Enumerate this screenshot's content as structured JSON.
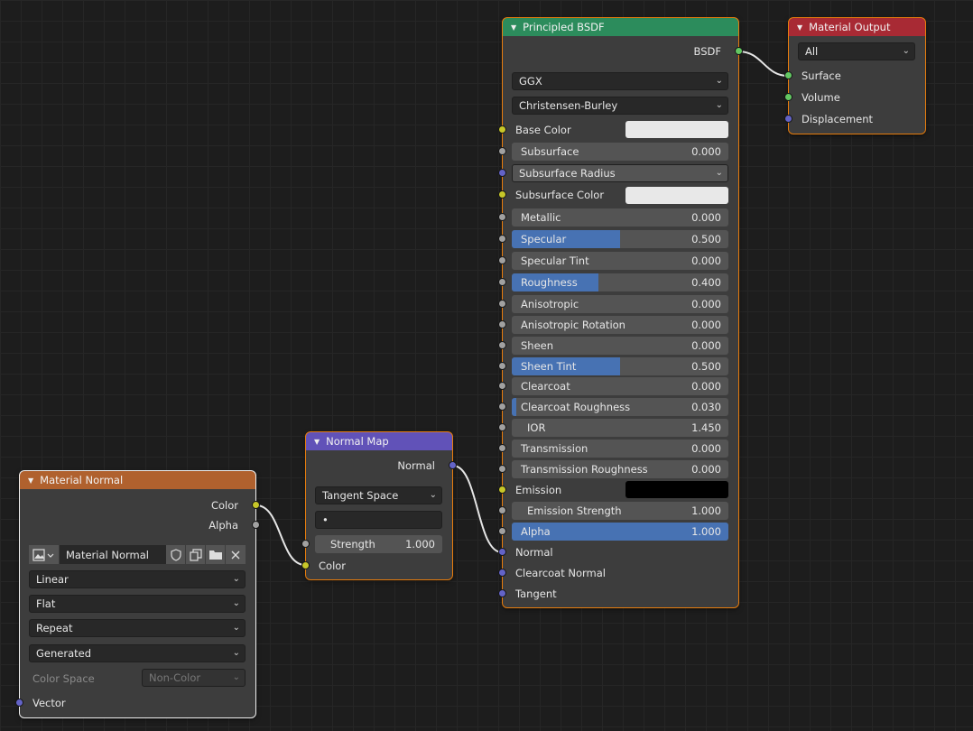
{
  "nodes": {
    "principled": {
      "title": "Principled BSDF",
      "output_label": "BSDF",
      "distribution": "GGX",
      "subsurface_method": "Christensen-Burley",
      "base_color_label": "Base Color",
      "subsurface": {
        "label": "Subsurface",
        "value": "0.000"
      },
      "subsurface_radius": "Subsurface Radius",
      "subsurface_color_label": "Subsurface Color",
      "metallic": {
        "label": "Metallic",
        "value": "0.000"
      },
      "specular": {
        "label": "Specular",
        "value": "0.500",
        "fraction": 0.5
      },
      "specular_tint": {
        "label": "Specular Tint",
        "value": "0.000"
      },
      "roughness": {
        "label": "Roughness",
        "value": "0.400",
        "fraction": 0.4
      },
      "anisotropic": {
        "label": "Anisotropic",
        "value": "0.000"
      },
      "anisotropic_rotation": {
        "label": "Anisotropic Rotation",
        "value": "0.000"
      },
      "sheen": {
        "label": "Sheen",
        "value": "0.000"
      },
      "sheen_tint": {
        "label": "Sheen Tint",
        "value": "0.500",
        "fraction": 0.5
      },
      "clearcoat": {
        "label": "Clearcoat",
        "value": "0.000"
      },
      "clearcoat_roughness": {
        "label": "Clearcoat Roughness",
        "value": "0.030",
        "fraction": 0.03
      },
      "ior": {
        "label": "IOR",
        "value": "1.450"
      },
      "transmission": {
        "label": "Transmission",
        "value": "0.000"
      },
      "transmission_roughness": {
        "label": "Transmission Roughness",
        "value": "0.000"
      },
      "emission_label": "Emission",
      "emission_strength": {
        "label": "Emission Strength",
        "value": "1.000"
      },
      "alpha": {
        "label": "Alpha",
        "value": "1.000",
        "fraction": 1.0
      },
      "normal_label": "Normal",
      "clearcoat_normal_label": "Clearcoat Normal",
      "tangent_label": "Tangent",
      "header_color": "#2c8c5c"
    },
    "material_output": {
      "title": "Material Output",
      "target": "All",
      "surface_label": "Surface",
      "volume_label": "Volume",
      "displacement_label": "Displacement",
      "header_color": "#a82a34"
    },
    "normal_map": {
      "title": "Normal Map",
      "output_label": "Normal",
      "space": "Tangent Space",
      "uv_map": "•",
      "strength": {
        "label": "Strength",
        "value": "1.000"
      },
      "color_label": "Color",
      "header_color": "#6152b8"
    },
    "image_texture": {
      "title": "Material Normal",
      "color_label": "Color",
      "alpha_label": "Alpha",
      "image_name": "Material Normal",
      "interpolation": "Linear",
      "projection": "Flat",
      "extension": "Repeat",
      "source": "Generated",
      "color_space_label": "Color Space",
      "color_space": "Non-Color",
      "vector_label": "Vector",
      "header_color": "#b0612e"
    }
  },
  "colors": {
    "base_color": "#e8e8e8",
    "subsurface_color": "#e8e8e8",
    "emission_color": "#000000",
    "selection_outline": "#e87d0d",
    "slider_fill": "#4772b3"
  },
  "icons": [
    "collapse-triangle-icon",
    "chevron-down-icon",
    "image-browse-icon",
    "fake-user-shield-icon",
    "duplicate-icon",
    "open-folder-icon",
    "close-x-icon"
  ]
}
